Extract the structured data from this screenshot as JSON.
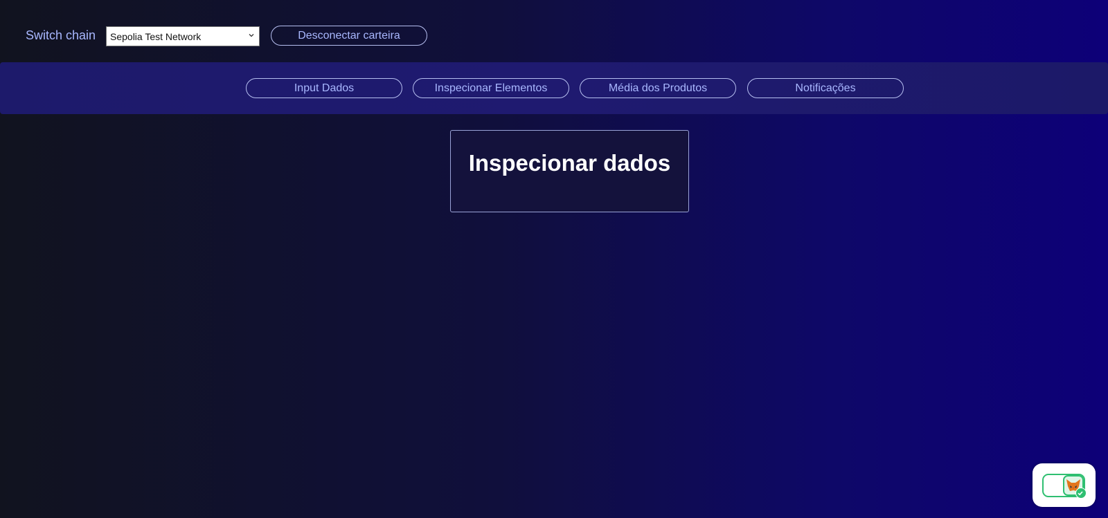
{
  "header": {
    "switch_label": "Switch chain",
    "chain_select": {
      "selected": "Sepolia Test Network"
    },
    "disconnect_label": "Desconectar carteira"
  },
  "nav": {
    "items": [
      {
        "label": "Input Dados"
      },
      {
        "label": "Inspecionar Elementos"
      },
      {
        "label": "Média dos Produtos"
      },
      {
        "label": "Notificações"
      }
    ]
  },
  "main": {
    "card_title": "Inspecionar dados"
  },
  "widget": {
    "icon": "metamask-fox-icon",
    "status_icon": "check-icon",
    "accent": "#2fbf71"
  },
  "colors": {
    "accent_text": "#a9b8ff",
    "nav_bg": "#1d1a6b",
    "bg_start": "#11131f",
    "bg_end": "#0d0078"
  }
}
